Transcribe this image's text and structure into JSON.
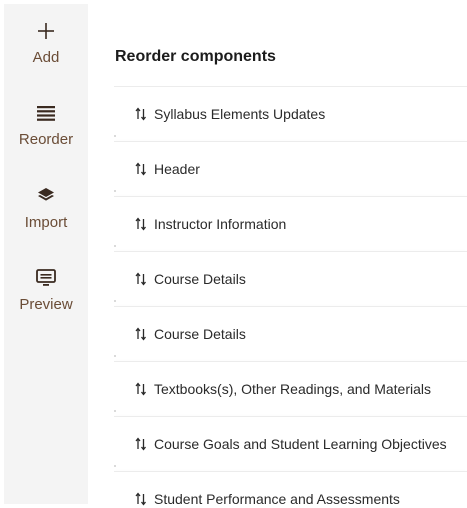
{
  "sidebar": {
    "items": [
      {
        "label": "Add",
        "icon": "plus-icon"
      },
      {
        "label": "Reorder",
        "icon": "list-icon"
      },
      {
        "label": "Import",
        "icon": "layers-icon"
      },
      {
        "label": "Preview",
        "icon": "monitor-icon"
      }
    ]
  },
  "panel": {
    "title": "Reorder components",
    "components": [
      {
        "label": "Syllabus Elements Updates"
      },
      {
        "label": "Header"
      },
      {
        "label": "Instructor Information"
      },
      {
        "label": "Course Details"
      },
      {
        "label": "Course Details"
      },
      {
        "label": "Textbooks(s), Other Readings, and Materials"
      },
      {
        "label": "Course Goals and Student Learning Objectives"
      },
      {
        "label": "Student Performance and Assessments"
      }
    ]
  },
  "colors": {
    "sidebar_bg": "#f4f4f4",
    "sidebar_text": "#6a4c36",
    "icon_dark": "#3a2a20",
    "title_text": "#1c1c1c",
    "row_text": "#2a2a2a"
  }
}
